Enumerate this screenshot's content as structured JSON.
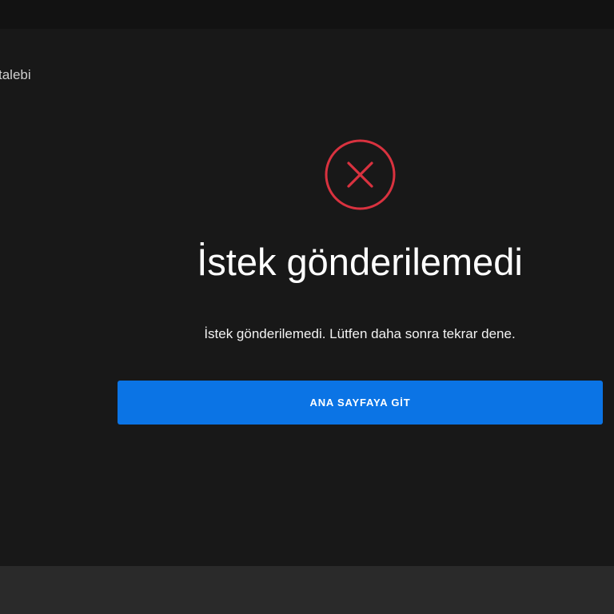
{
  "breadcrumb": {
    "label": "talebi"
  },
  "error": {
    "icon": "close-circle-icon",
    "icon_color": "#d9323f",
    "title": "İstek gönderilemedi",
    "message": "İstek gönderilemedi. Lütfen daha sonra tekrar dene."
  },
  "actions": {
    "home_label": "ANA SAYFAYA GİT",
    "button_color": "#0b74e5"
  }
}
